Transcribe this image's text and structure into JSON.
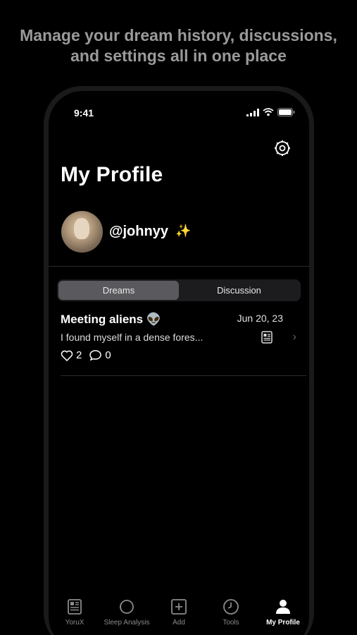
{
  "promo": {
    "line1": "Manage your dream history, discussions,",
    "line2": "and settings all in one place"
  },
  "status_bar": {
    "time": "9:41"
  },
  "profile": {
    "title": "My Profile",
    "handle": "@johnyy",
    "sparkle": "✨"
  },
  "segments": [
    {
      "label": "Dreams",
      "active": true
    },
    {
      "label": "Discussion",
      "active": false
    }
  ],
  "dreams": [
    {
      "title": "Meeting aliens 👽",
      "date": "Jun 20, 23",
      "excerpt": "I found myself in a dense fores...",
      "likes": "2",
      "comments": "0"
    }
  ],
  "tabbar": [
    {
      "label": "YoruX",
      "icon": "newspaper-icon"
    },
    {
      "label": "Sleep Analysis",
      "icon": "moon-icon"
    },
    {
      "label": "Add",
      "icon": "add-icon"
    },
    {
      "label": "Tools",
      "icon": "clock-icon"
    },
    {
      "label": "My Profile",
      "icon": "person-icon",
      "active": true
    }
  ],
  "colors": {
    "background": "#000000",
    "accent_sparkle": "#a8b8ff",
    "segment_active": "#5a5a5e"
  }
}
